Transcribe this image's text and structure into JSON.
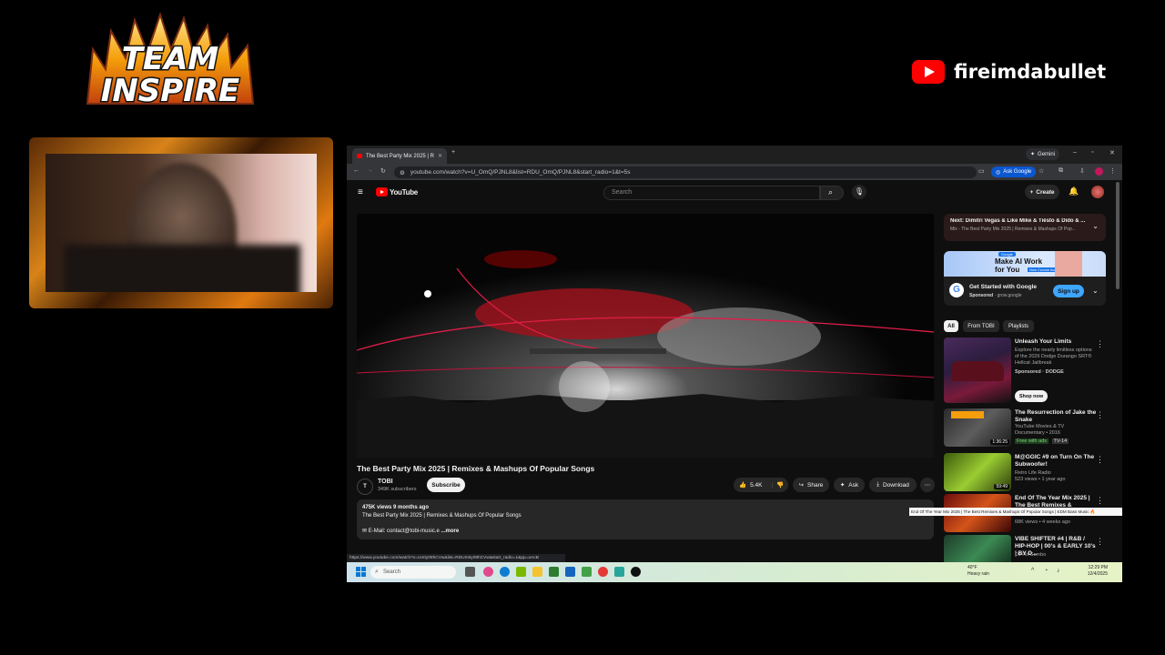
{
  "overlay": {
    "team_logo_line1": "TEAM",
    "team_logo_line2": "INSPIRE",
    "channel_name": "fireimdabullet",
    "channel_icon": "youtube-play-icon"
  },
  "browser": {
    "tab_title": "The Best Party Mix 2025 | R",
    "gemini_label": "Gemini",
    "url": "youtube.com/watch?v=U_OmQ/PJNL8&list=RDU_OmQ/PJNL8&start_radio=1&t=5s",
    "ask_google": "Ask Google"
  },
  "youtube": {
    "logo_text": "YouTube",
    "search_placeholder": "Search",
    "create_label": "Create",
    "video": {
      "title": "The Best Party Mix 2025 | Remixes & Mashups Of Popular Songs",
      "channel": "TOBI",
      "subscribers": "349K subscribers",
      "subscribe_label": "Subscribe",
      "likes": "5.4K",
      "share_label": "Share",
      "ask_label": "Ask",
      "download_label": "Download",
      "views_line": "475K views  9 months ago",
      "desc_line1": "The Best Party Mix 2025 | Remixes & Mashups Of Popular Songs",
      "desc_email": "E-Mail: contact@tobi-music.e",
      "desc_more": "...more"
    },
    "next": {
      "title": "Next: Dimitri Vegas & Like Mike & Tiësto & Dido & ...",
      "subtitle": "Mix - The Best Party Mix 2025 | Remixes & Mashups Of Pop..."
    },
    "ad": {
      "banner_line1": "Make AI Work",
      "banner_line2": "for You",
      "banner_tag": "Google",
      "banner_sub": "Now Course Available",
      "title": "Get Started with Google",
      "sponsor": "Sponsored",
      "domain": "· grow.google",
      "cta": "Sign up"
    },
    "chips": [
      "All",
      "From TOBI",
      "Playlists"
    ],
    "recommendations": [
      {
        "title": "Unleash Your Limits",
        "meta1": "Explore the nearly limitless options of the 2026 Dodge Durango SRT® Hellcat Jailbreak",
        "meta2": "Sponsored · DODGE",
        "cta": "Shop now",
        "duration": ""
      },
      {
        "title": "The Resurrection of Jake the Snake",
        "meta1": "YouTube Movies & TV",
        "meta2": "Documentary • 2016",
        "badge1": "Free with ads",
        "badge2": "TV-14",
        "duration": "1:36:25"
      },
      {
        "title": "M@GGIC #9 on Turn On The Subwoofer!",
        "meta1": "Retro Life Radio",
        "meta2": "523 views • 1 year ago",
        "duration": "59:49"
      },
      {
        "title": "End Of The Year Mix 2025 | The Best Remixes & Mashups Of...",
        "meta1": "68K views • 4 weeks ago",
        "meta2": "",
        "duration": ""
      },
      {
        "title": "VIBE SHIFTER #4 | R&B / HIP-HOP | 00's & EARLY 10's | BY D...",
        "meta1": "DJ Hit Combo",
        "meta2": "",
        "duration": ""
      }
    ],
    "tooltip": "End Of The Year Mix 2025 | The Best Remixes & Mashups Of Popular Songs | EDM Bass Music 🔥",
    "status_url": "https://www.youtube.com/watch?v=Un0y09hCVw&list=RDUm0y09hCVw&start_radio=1&pp=oAcB"
  },
  "taskbar": {
    "search_placeholder": "Search",
    "weather_temp": "40°F",
    "weather_desc": "Heavy rain",
    "time": "12:29 PM",
    "date": "12/4/2025"
  },
  "colors": {
    "yt_red": "#ff0000",
    "subscribe_bg": "#f1f1f1",
    "ask_google_blue": "#0b57d0",
    "flame": "#f08a12"
  }
}
